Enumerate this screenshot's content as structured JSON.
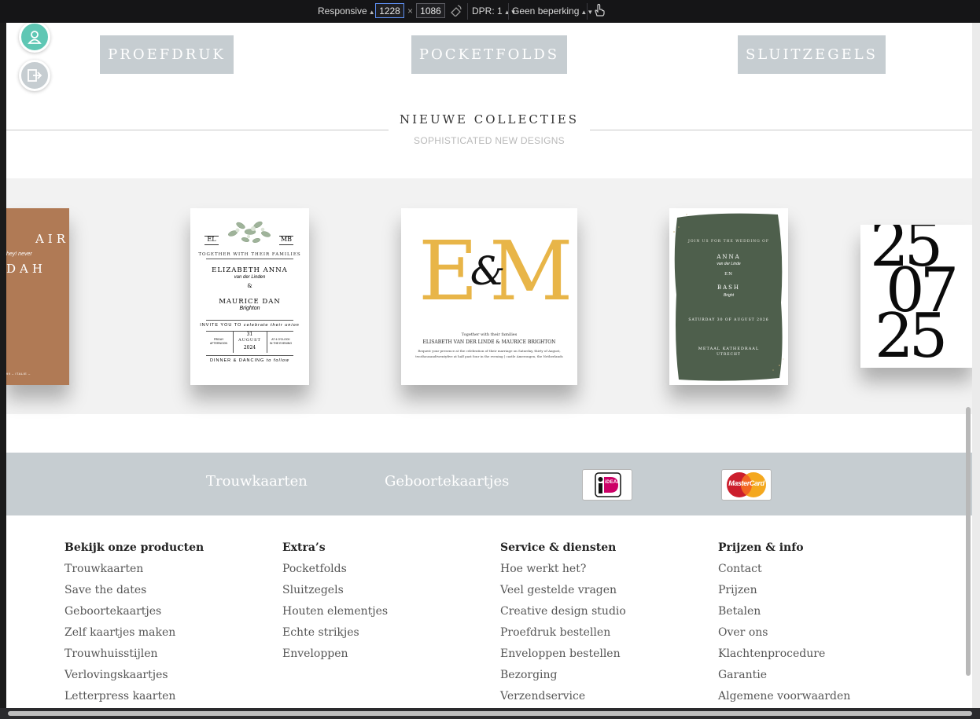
{
  "devtools": {
    "mode": "Responsive",
    "width": "1228",
    "times": "×",
    "height": "1086",
    "dpr": "DPR: 1",
    "throttle": "Geen beperking"
  },
  "categories": [
    "PROEFDRUK",
    "POCKETFOLDS",
    "SLUITZEGELS"
  ],
  "section": {
    "title": "NIEUWE COLLECTIES",
    "subtitle": "SOPHISTICATED NEW DESIGNS"
  },
  "cards": {
    "first": {
      "line1": "AIR",
      "script": "hey! never",
      "line2": "DAH",
      "footer": "99 – ITALIE –"
    },
    "floral": {
      "mono_left": "EL",
      "mono_right": "MB",
      "line1": "TOGETHER WITH THEIR FAMILIES",
      "name1": "ELIZABETH ANNA",
      "script1": "van der Linden",
      "amp": "&",
      "name2": "MAURICE DAN",
      "script2": "Brighton",
      "invite": "INVITE YOU TO",
      "invite_script": "celebrate their union",
      "day": "FRIDAY",
      "time": "AFTERNOON",
      "num": "31",
      "month": "AUGUST",
      "year": "2024",
      "at": "AT 4 O'CLOCK",
      "place": "IN THE EVENING",
      "bottom": "DINNER & DANCING",
      "bottom_script": "to follow"
    },
    "em": {
      "l1": "E",
      "amp": "&",
      "l2": "M",
      "together": "Together with their families",
      "names": "ELISABETH VAN DER LINDE & MAURICE BRIGHTON",
      "text1": "Request your presence at the celebration of their marriage on Saturday, thirty of August,",
      "text2": "twothousandtwentyfive at half past four in the evening | castle Amerongen, the Netherlands"
    },
    "green": {
      "intro": "JOIN US FOR THE WEDDING OF",
      "name1": "ANNA",
      "script1": "van der Linde",
      "en": "EN",
      "name2": "BASH",
      "script2": "Bright",
      "date": "SATURDAY 30 OF AUGUST 2026",
      "venue": "METAAL KATHEDRAAL",
      "city": "UTRECHT"
    },
    "date_card": {
      "d1": "25",
      "d2": "07",
      "d3": "25"
    }
  },
  "footer_bar": {
    "link1": "Trouwkaarten",
    "link2": "Geboortekaartjes",
    "ideal": "iDEAL",
    "mastercard": "MasterCard"
  },
  "columns": [
    {
      "title": "Bekijk onze producten",
      "items": [
        "Trouwkaarten",
        "Save the dates",
        "Geboortekaartjes",
        "Zelf kaartjes maken",
        "Trouwhuisstijlen",
        "Verlovingskaartjes",
        "Letterpress kaarten"
      ]
    },
    {
      "title": "Extra’s",
      "items": [
        "Pocketfolds",
        "Sluitzegels",
        "Houten elementjes",
        "Echte strikjes",
        "Enveloppen"
      ]
    },
    {
      "title": "Service & diensten",
      "items": [
        "Hoe werkt het?",
        "Veel gestelde vragen",
        "Creative design studio",
        "Proefdruk bestellen",
        "Enveloppen bestellen",
        "Bezorging",
        "Verzendservice"
      ]
    },
    {
      "title": "Prijzen & info",
      "items": [
        "Contact",
        "Prijzen",
        "Betalen",
        "Over ons",
        "Klachtenprocedure",
        "Garantie",
        "Algemene voorwaarden"
      ]
    }
  ],
  "colors": {
    "accent_grey": "#c6cdd1",
    "mustard": "#e8b548",
    "green": "#4e5f4c",
    "terracotta": "#b07a55",
    "teal": "#5fc7b4"
  }
}
